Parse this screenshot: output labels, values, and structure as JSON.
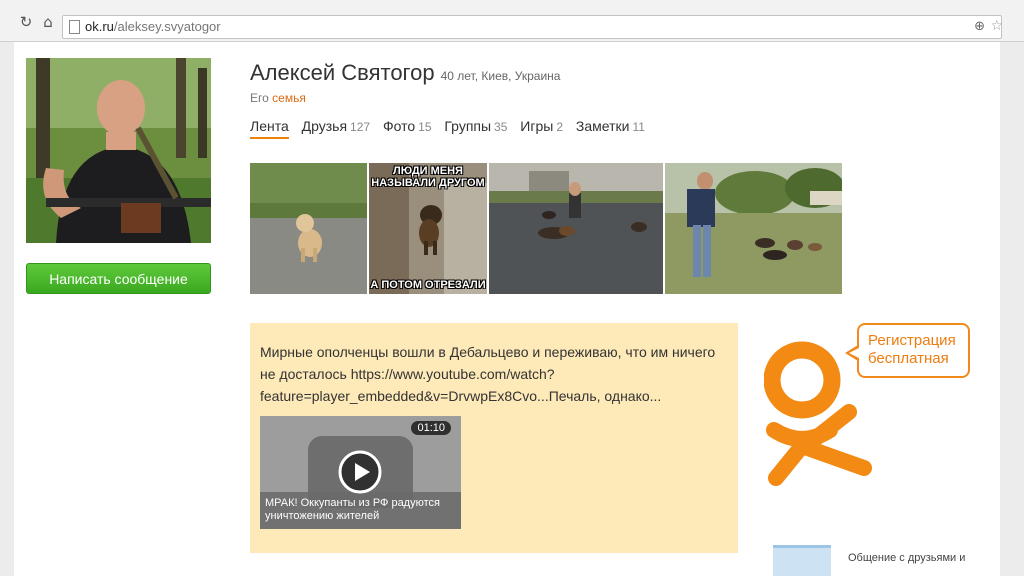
{
  "browser": {
    "url_host": "ok.ru",
    "url_path": "/aleksey.svyatogor"
  },
  "profile": {
    "name": "Алексей Святогор",
    "meta": "40 лет, Киев, Украина",
    "relation_prefix": "Его",
    "relation_link": "семья",
    "message_button": "Написать сообщение"
  },
  "tabs": [
    {
      "label": "Лента",
      "count": ""
    },
    {
      "label": "Друзья",
      "count": "127"
    },
    {
      "label": "Фото",
      "count": "15"
    },
    {
      "label": "Группы",
      "count": "35"
    },
    {
      "label": "Игры",
      "count": "2"
    },
    {
      "label": "Заметки",
      "count": "11"
    }
  ],
  "photos": {
    "meme_top": "ЛЮДИ МЕНЯ НАЗЫВАЛИ ДРУГОМ",
    "meme_bottom": "А ПОТОМ ОТРЕЗАЛИ"
  },
  "post": {
    "text": "Мирные ополченцы вошли в Дебальцево и переживаю, что им ничего не досталось https://www.youtube.com/watch?feature=player_embedded&v=DrvwpEx8Cvo...Печаль, однако...",
    "video_duration": "01:10",
    "video_title": "МРАК! Оккупанты из РФ радуются уничтожению жителей"
  },
  "sidebar": {
    "register_bubble": "Регистрация бесплатная",
    "promo_text": "Общение с друзьями и"
  },
  "colors": {
    "accent": "#ee8208",
    "button_green": "#4cb92c",
    "post_background": "#fee9b8"
  }
}
